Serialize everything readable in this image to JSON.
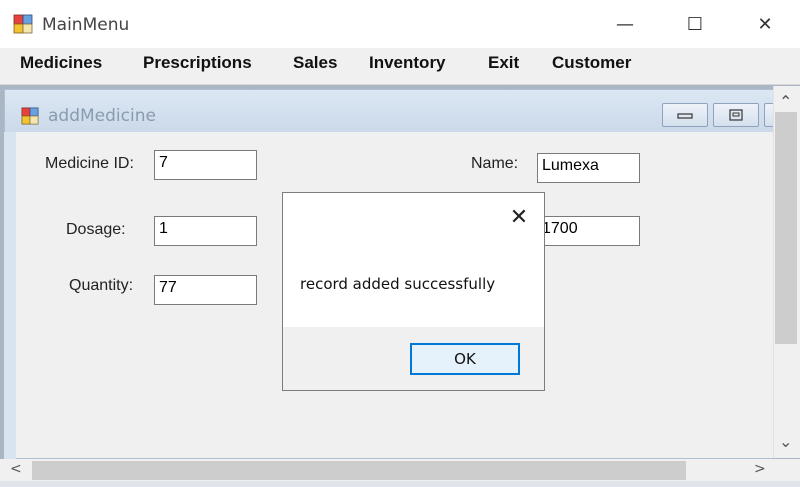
{
  "window": {
    "title": "MainMenu",
    "minimize_glyph": "—",
    "maximize_glyph": "☐",
    "close_glyph": "✕"
  },
  "menu": [
    "Medicines",
    "Prescriptions",
    "Sales",
    "Inventory",
    "Exit",
    "Customer"
  ],
  "child": {
    "title": "addMedicine",
    "fields": {
      "medicine_id_label": "Medicine ID:",
      "medicine_id_value": "7",
      "name_label": "Name:",
      "name_value": "Lumexa",
      "dosage_label": "Dosage:",
      "dosage_value": "1",
      "price_value": "1700",
      "quantity_label": "Quantity:",
      "quantity_value": "77"
    }
  },
  "dialog": {
    "message": "record added successfully",
    "ok_label": "OK",
    "close_glyph": "✕"
  },
  "scroll": {
    "up": "⌃",
    "down": "⌄",
    "left": "<",
    "right": ">"
  },
  "colors": {
    "accent": "#0078d7",
    "mdi_background": "#abb6c4"
  }
}
